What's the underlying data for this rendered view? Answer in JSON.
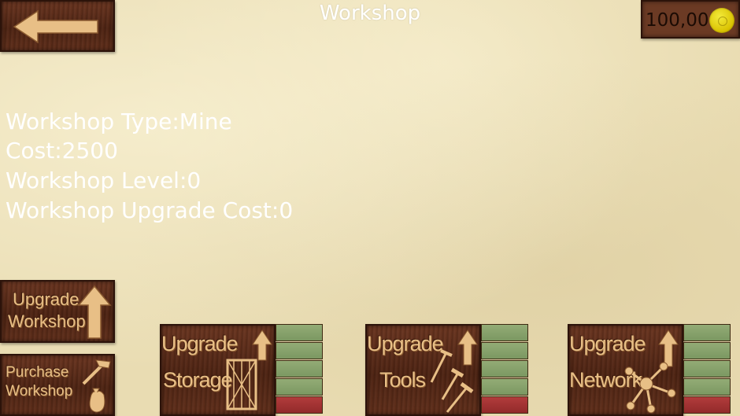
{
  "header": {
    "title": "Workshop",
    "back_icon": "back-arrow-icon"
  },
  "wallet": {
    "amount": "100,00",
    "icon": "gold-coin-icon"
  },
  "info": {
    "type": "Workshop Type:Mine",
    "cost": "Cost:2500",
    "level": "Workshop Level:0",
    "upgrade_cost": "Workshop Upgrade Cost:0"
  },
  "left_buttons": {
    "upgrade_workshop": {
      "line1": "Upgrade",
      "line2": "Workshop"
    },
    "purchase_workshop": {
      "line1": "Purchase",
      "line2": "Workshop"
    }
  },
  "upgrades": [
    {
      "line1": "Upgrade",
      "line2": "Storage",
      "icon": "crate-icon",
      "filled": 4,
      "total": 5
    },
    {
      "line1": "Upgrade",
      "line2": "Tools",
      "icon": "tools-icon",
      "filled": 4,
      "total": 5
    },
    {
      "line1": "Upgrade",
      "line2": "Network",
      "icon": "network-icon",
      "filled": 4,
      "total": 5
    }
  ],
  "colors": {
    "wood": "#5a2a17",
    "carving": "#e8bf86",
    "level_filled": "#86a06a",
    "level_empty": "#a53333",
    "coin": "#e6d51c"
  }
}
